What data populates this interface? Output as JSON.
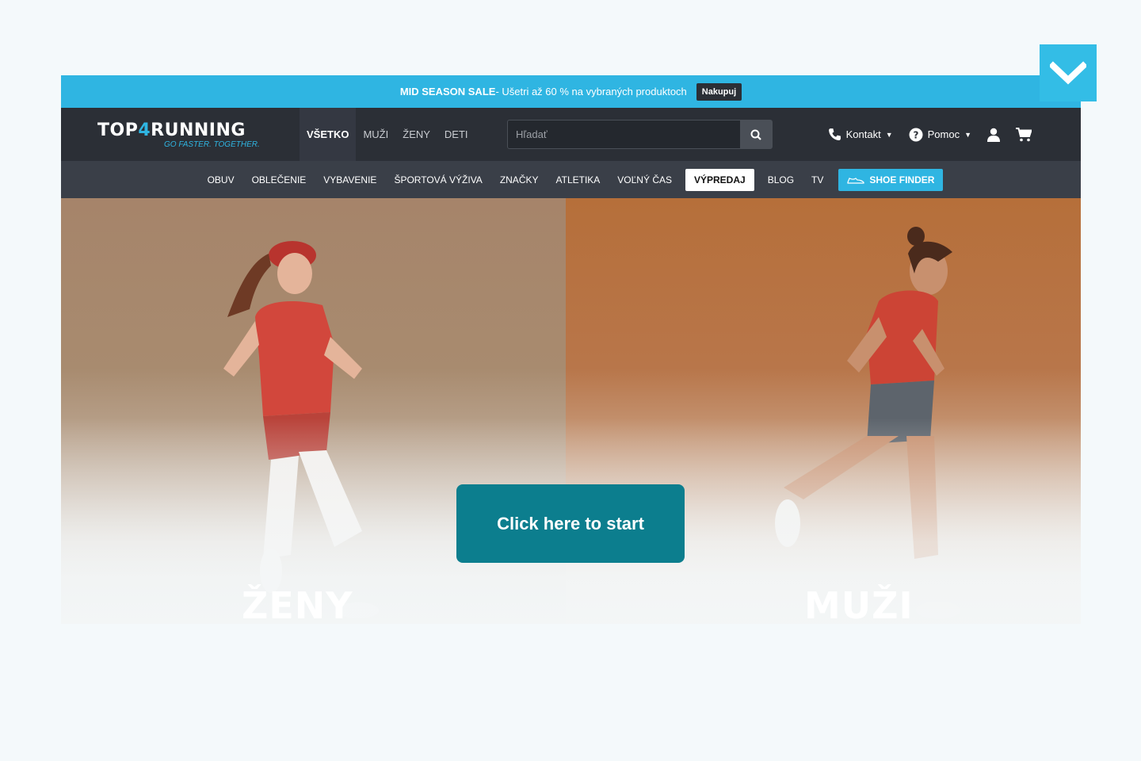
{
  "promo": {
    "title": "MID SEASON SALE",
    "text": " - Ušetri až 60 % na vybraných produktoch",
    "button": "Nakupuj"
  },
  "header": {
    "logo_top": "TOP",
    "logo_four": "4",
    "logo_rest": "RUNNING",
    "tagline": "GO FASTER. TOGETHER.",
    "gender_nav": [
      "VŠETKO",
      "MUŽI",
      "ŽENY",
      "DETI"
    ],
    "search_placeholder": "Hľadať",
    "contact": "Kontakt",
    "help": "Pomoc"
  },
  "categories": [
    "OBUV",
    "OBLEČENIE",
    "VYBAVENIE",
    "ŠPORTOVÁ VÝŽIVA",
    "ZNAČKY",
    "ATLETIKA",
    "VOĽNÝ ČAS",
    "VÝPREDAJ",
    "BLOG",
    "TV",
    "SHOE FINDER"
  ],
  "hero": {
    "left_label": "ŽENY",
    "right_label": "MUŽI"
  },
  "cta_label": "Click here to start",
  "colors": {
    "accent": "#2fb5e2",
    "header_bg": "#2b2f36",
    "cta": "#0c7e8e"
  },
  "icons": {
    "search": "search-icon",
    "phone": "phone-icon",
    "help": "help-circle-icon",
    "user": "user-icon",
    "cart": "cart-icon",
    "collapse": "chevron-down-icon",
    "shoe": "shoe-icon"
  }
}
